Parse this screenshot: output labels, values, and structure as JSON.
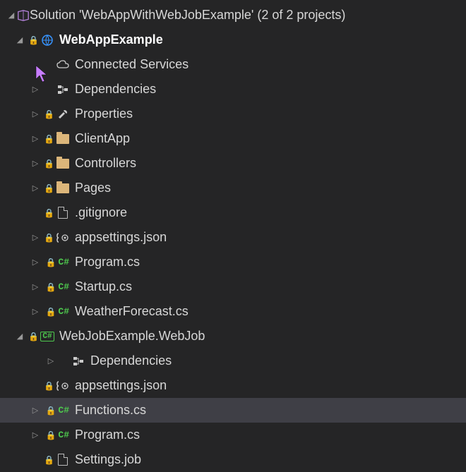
{
  "solution": {
    "label": "Solution 'WebAppWithWebJobExample' (2 of 2 projects)"
  },
  "projectA": {
    "name": "WebAppExample",
    "items": {
      "connected": "Connected Services",
      "deps": "Dependencies",
      "props": "Properties",
      "clientapp": "ClientApp",
      "controllers": "Controllers",
      "pages": "Pages",
      "gitignore": ".gitignore",
      "appsettings": "appsettings.json",
      "program": "Program.cs",
      "startup": "Startup.cs",
      "weather": "WeatherForecast.cs"
    }
  },
  "projectB": {
    "name": "WebJobExample.WebJob",
    "items": {
      "deps": "Dependencies",
      "appsettings": "appsettings.json",
      "functions": "Functions.cs",
      "program": "Program.cs",
      "settings": "Settings.job"
    }
  },
  "colors": {
    "accent": "#3794ff",
    "green": "#4ec94e",
    "folder": "#dcb67a"
  }
}
